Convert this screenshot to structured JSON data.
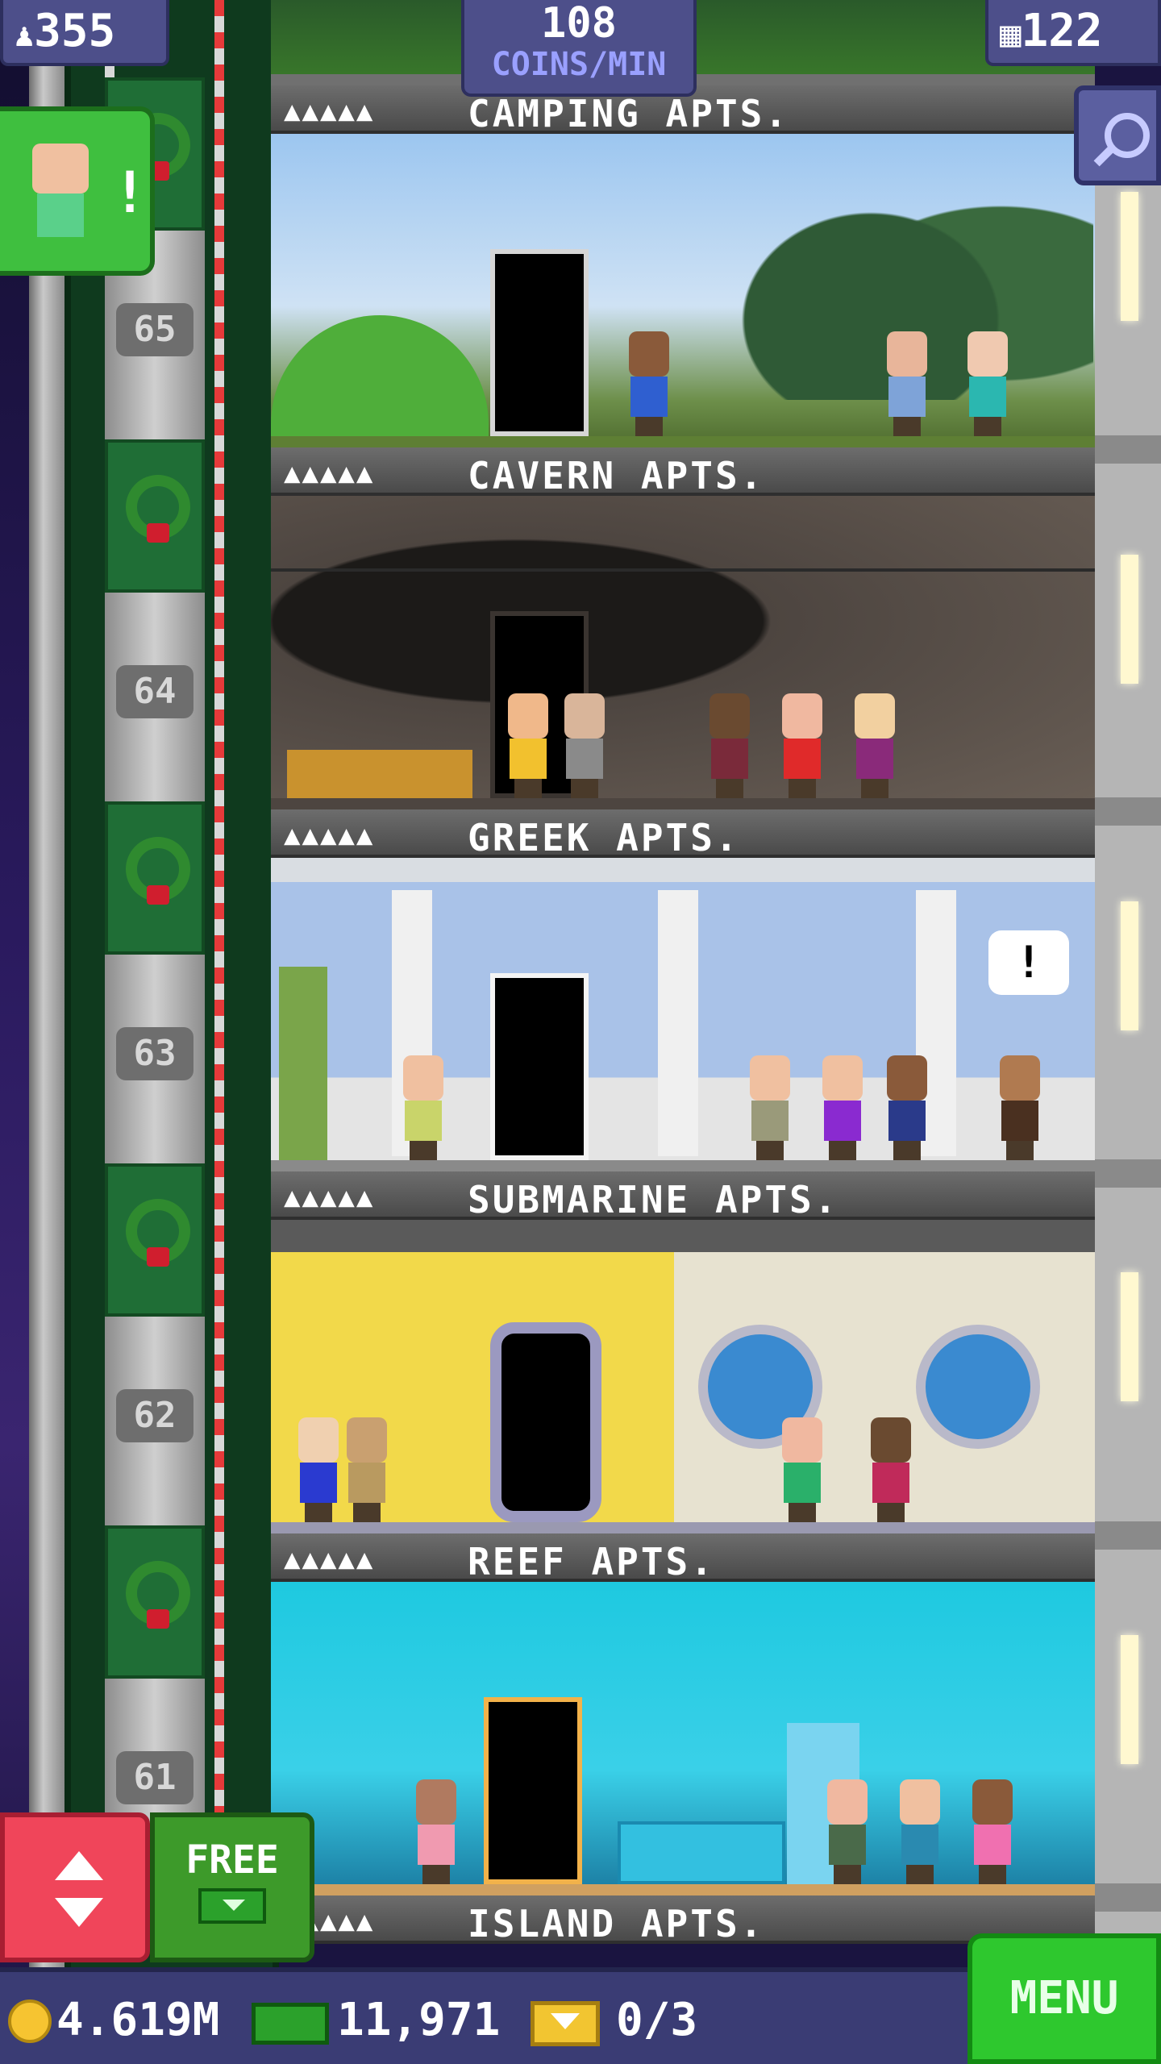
{
  "top_bar": {
    "population": "355",
    "coins_per_min_value": "108",
    "coins_per_min_label": "COINS/MIN",
    "floors": "122"
  },
  "elevator_floors": [
    "65",
    "64",
    "63",
    "62",
    "61"
  ],
  "storeys": [
    {
      "people": "▲▲▲▲▲",
      "name": "CAMPING APTS."
    },
    {
      "people": "▲▲▲▲▲",
      "name": "CAVERN APTS."
    },
    {
      "people": "▲▲▲▲▲",
      "name": "GREEK APTS."
    },
    {
      "people": "▲▲▲▲▲",
      "name": "SUBMARINE APTS."
    },
    {
      "people": "▲▲▲▲▲",
      "name": "REEF APTS."
    },
    {
      "people": "▲▲▲▲▲",
      "name": "ISLAND APTS."
    }
  ],
  "notification": {
    "mark": "!"
  },
  "buttons": {
    "free_label": "FREE",
    "menu_label": "MENU"
  },
  "bottom_bar": {
    "coins": "4.619M",
    "bux": "11,971",
    "tickets": "0/3"
  },
  "colors": {
    "accent_green": "#2ec82e",
    "accent_red": "#f0455a",
    "panel_purple": "#4d4f8a"
  }
}
